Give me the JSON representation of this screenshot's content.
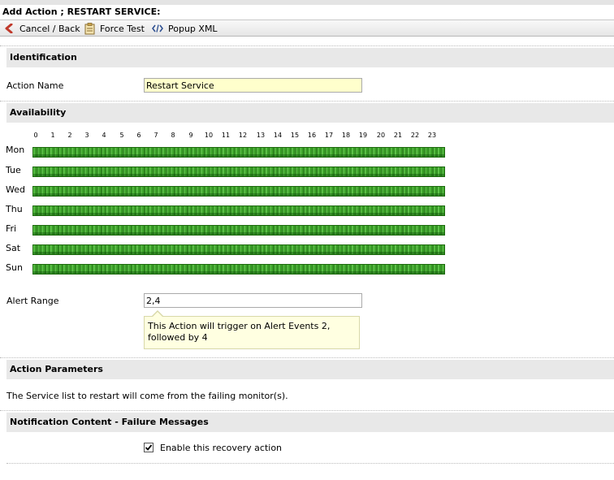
{
  "title": "Add Action ; RESTART SERVICE:",
  "toolbar": {
    "cancel_label": "Cancel / Back",
    "force_test_label": "Force Test",
    "popup_xml_label": "Popup XML"
  },
  "sections": {
    "identification": "Identification",
    "availability": "Availability",
    "action_parameters": "Action Parameters",
    "notification": "Notification Content - Failure Messages"
  },
  "identification": {
    "action_name_label": "Action Name",
    "action_name_value": "Restart Service"
  },
  "availability": {
    "hours": [
      "0",
      "1",
      "2",
      "3",
      "4",
      "5",
      "6",
      "7",
      "8",
      "9",
      "10",
      "11",
      "12",
      "13",
      "14",
      "15",
      "16",
      "17",
      "18",
      "19",
      "20",
      "21",
      "22",
      "23"
    ],
    "days": [
      "Mon",
      "Tue",
      "Wed",
      "Thu",
      "Fri",
      "Sat",
      "Sun"
    ],
    "all_hours_enabled": true,
    "enabled_color": "#3ea52b"
  },
  "alert_range": {
    "label": "Alert Range",
    "value": "2,4",
    "tooltip": "This Action will trigger on Alert Events 2, followed by 4"
  },
  "action_parameters": {
    "description": "The Service list to restart will come from the failing monitor(s)."
  },
  "notification": {
    "enable_label": "Enable this recovery action",
    "enabled": true
  }
}
